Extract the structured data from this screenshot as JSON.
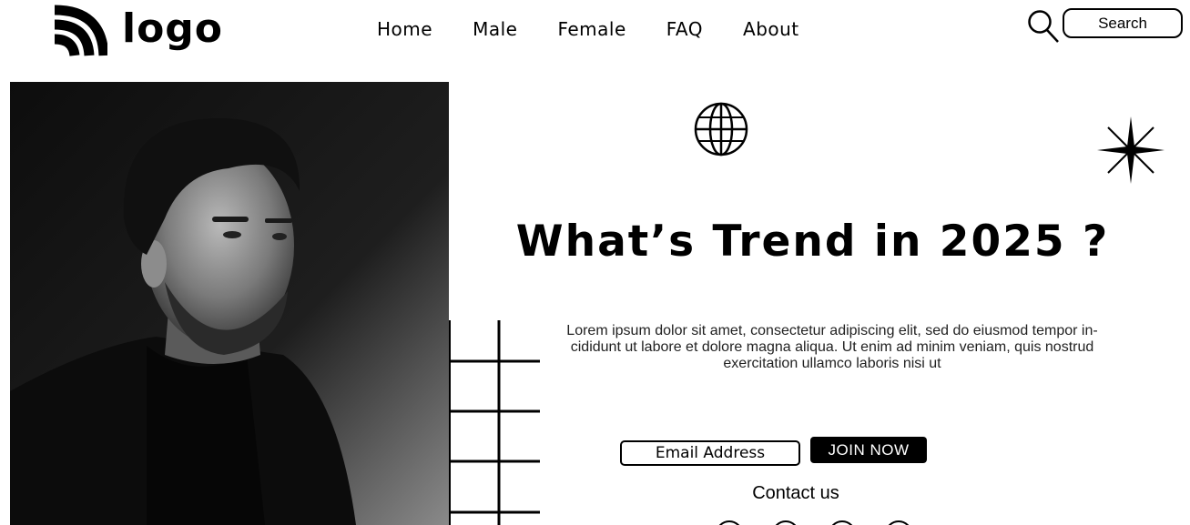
{
  "header": {
    "logo_text": "logo",
    "nav": [
      {
        "label": "Home"
      },
      {
        "label": "Male"
      },
      {
        "label": "Female"
      },
      {
        "label": "FAQ"
      },
      {
        "label": "About"
      }
    ],
    "search": {
      "placeholder": "Search",
      "icon": "search-icon"
    }
  },
  "hero": {
    "image": "portrait-photo",
    "headline": "What’s Trend in 2025 ?",
    "description": "Lorem ipsum dolor sit amet, consectetur adipiscing elit, sed do eiusmod tempor in-cididunt ut labore et dolore magna aliqua. Ut enim ad minim veniam, quis nostrud exercitation ullamco laboris nisi ut",
    "email_placeholder": "Email Address",
    "join_label": "JOIN NOW",
    "contact_title": "Contact us",
    "social_icons": [
      "social-icon-1",
      "social-icon-2",
      "social-icon-3",
      "social-icon-4"
    ]
  },
  "decorations": [
    "globe-icon",
    "sparkle-icon",
    "grid-lines"
  ]
}
